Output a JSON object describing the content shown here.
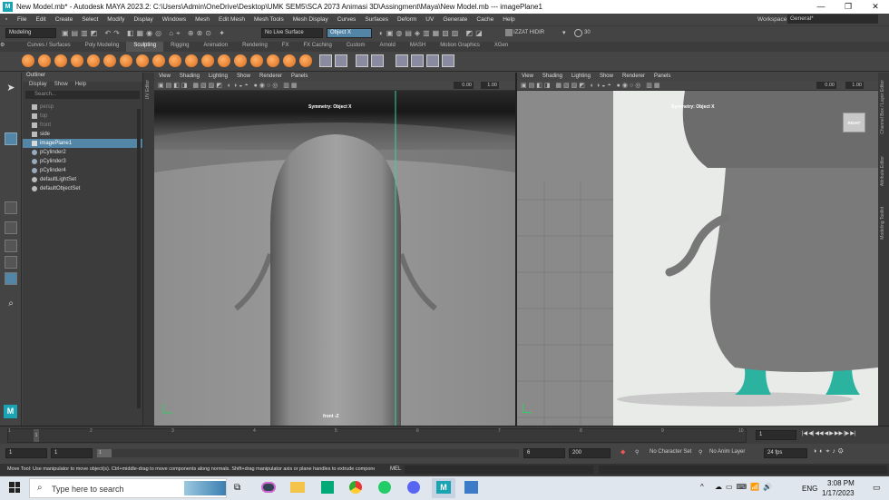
{
  "window": {
    "title": "New Model.mb* - Autodesk MAYA 2023.2: C:\\Users\\Admin\\OneDrive\\Desktop\\UMK SEM5\\SCA 2073 Animasi 3D\\Assingment\\Maya\\New Model.mb   ---   imagePlane1",
    "logo": "M",
    "minimize": "—",
    "maximize": "❐",
    "close": "✕"
  },
  "menubar": {
    "items": [
      "File",
      "Edit",
      "Create",
      "Select",
      "Modify",
      "Display",
      "Windows",
      "Mesh",
      "Edit Mesh",
      "Mesh Tools",
      "Mesh Display",
      "Curves",
      "Surfaces",
      "Deform",
      "UV",
      "Generate",
      "Cache",
      "Help"
    ],
    "workspace_label": "Workspace :",
    "workspace_value": "General*"
  },
  "statusline": {
    "menuset": "Modeling",
    "live_surface": "No Live Surface",
    "symmetry": "Object X",
    "user": "IZZAT HIDIR",
    "credits": "30"
  },
  "shelf": {
    "tabs": [
      "Curves / Surfaces",
      "Poly Modeling",
      "Sculpting",
      "Rigging",
      "Animation",
      "Rendering",
      "FX",
      "FX Caching",
      "Custom",
      "Arnold",
      "MASH",
      "Motion Graphics",
      "XGen"
    ],
    "active_tab": "Sculpting"
  },
  "outliner": {
    "title": "Outliner",
    "menu": [
      "Display",
      "Show",
      "Help"
    ],
    "search_placeholder": "Search...",
    "items": [
      {
        "label": "persp",
        "state": "dim"
      },
      {
        "label": "top",
        "state": "dim"
      },
      {
        "label": "front",
        "state": "dim"
      },
      {
        "label": "side",
        "state": "normal"
      },
      {
        "label": "imagePlane1",
        "state": "selected"
      },
      {
        "label": "pCylinder2",
        "state": "normal"
      },
      {
        "label": "pCylinder3",
        "state": "normal"
      },
      {
        "label": "pCylinder4",
        "state": "normal"
      },
      {
        "label": "defaultLightSet",
        "state": "normal"
      },
      {
        "label": "defaultObjectSet",
        "state": "normal"
      }
    ]
  },
  "side_tabs": {
    "uv_editor": "UV Editor",
    "channel_box": "Channel Box / Layer Editor",
    "attribute_editor": "Attribute Editor",
    "modeling_toolkit": "Modeling Toolkit"
  },
  "viewport_left": {
    "menu": [
      "View",
      "Shading",
      "Lighting",
      "Show",
      "Renderer",
      "Panels"
    ],
    "symmetry_label": "Symmetry: Object X",
    "camera_label": "front -Z",
    "field_a": "0.00",
    "field_b": "1.00"
  },
  "viewport_right": {
    "menu": [
      "View",
      "Shading",
      "Lighting",
      "Show",
      "Renderer",
      "Panels"
    ],
    "symmetry_label": "Symmetry: Object X",
    "viewcube_label": "RIGHT",
    "field_a": "0.00",
    "field_b": "1.00"
  },
  "timeslider": {
    "ticks": [
      "1",
      "2",
      "3",
      "4",
      "5",
      "6",
      "7",
      "8",
      "9",
      "10"
    ],
    "current_frame": "1",
    "playback_buttons": [
      "|◀",
      "◀|",
      "◀◀",
      "◀",
      "▶",
      "▶▶",
      "|▶",
      "▶|"
    ]
  },
  "rangebar": {
    "start": "1",
    "start_inner": "1",
    "range_label": "1",
    "end_inner": "6",
    "end": "200",
    "character_set": "No Character Set",
    "anim_layer": "No Anim Layer",
    "fps": "24 fps"
  },
  "cmdline": {
    "help_text": "Move Tool: Use manipulator to move object(s). Ctrl+middle-drag to move components along normals. Shift+drag manipulator axis or plane handles to extrude components or c",
    "mel_label": "MEL"
  },
  "taskbar": {
    "search_placeholder": "Type here to search",
    "language": "ENG",
    "time": "3:08 PM",
    "date": "1/17/2023"
  },
  "colors": {
    "accent": "#5285a6",
    "maya_teal": "#19a3b3",
    "shelf_orange": "#e8852f"
  }
}
